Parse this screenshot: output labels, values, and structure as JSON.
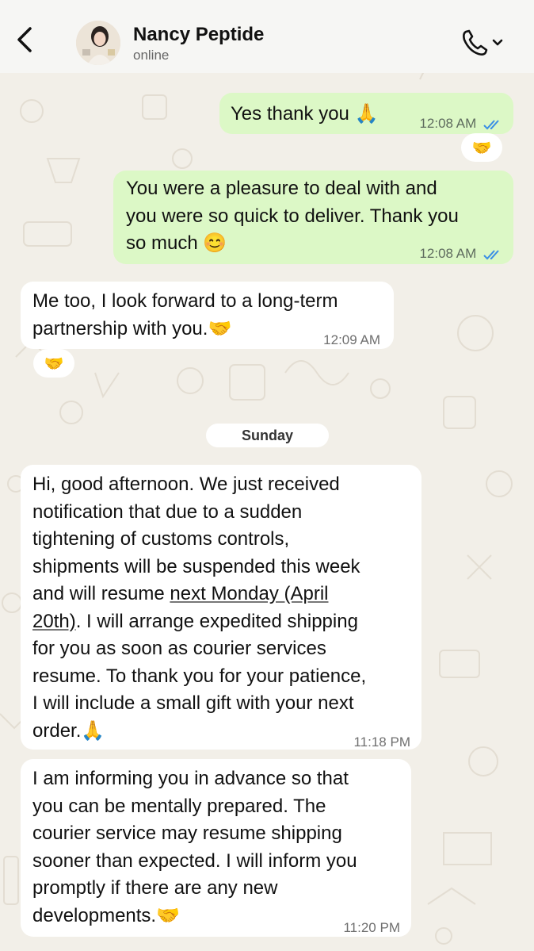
{
  "header": {
    "contact_name": "Nancy Peptide",
    "status": "online"
  },
  "messages": [
    {
      "direction": "outgoing",
      "text": "Yes thank you 🙏",
      "time": "12:08 AM",
      "read": true
    },
    {
      "direction": "outgoing",
      "reaction": "🤝"
    },
    {
      "direction": "outgoing",
      "text_lines": [
        "You were a pleasure to deal with and",
        "you were so quick to deliver. Thank you",
        "so much 😊"
      ],
      "time": "12:08 AM",
      "read": true
    },
    {
      "direction": "incoming",
      "text_lines": [
        "Me too, I look forward to a long-term",
        "partnership with you.🤝"
      ],
      "time": "12:09 AM"
    },
    {
      "direction": "incoming",
      "reaction": "🤝"
    },
    {
      "day_separator": "Sunday"
    },
    {
      "direction": "incoming",
      "text_lines": [
        "Hi, good afternoon. We just received",
        "notification that due to a sudden",
        "tightening of customs controls,",
        "shipments will be suspended this week",
        "and will resume ",
        "next Monday (April",
        "20th)",
        ". I will arrange expedited shipping",
        "for you as soon as courier services",
        "resume. To thank you for your patience,",
        "I will include a small gift with your next",
        "order.🙏"
      ],
      "time": "11:18 PM"
    },
    {
      "direction": "incoming",
      "text_lines": [
        "I am informing you in advance so that",
        "you can be mentally prepared. The",
        "courier service may resume shipping",
        "sooner than expected. I will inform you",
        "promptly if there are any new",
        "developments.🤝"
      ],
      "time": "11:20 PM"
    }
  ]
}
